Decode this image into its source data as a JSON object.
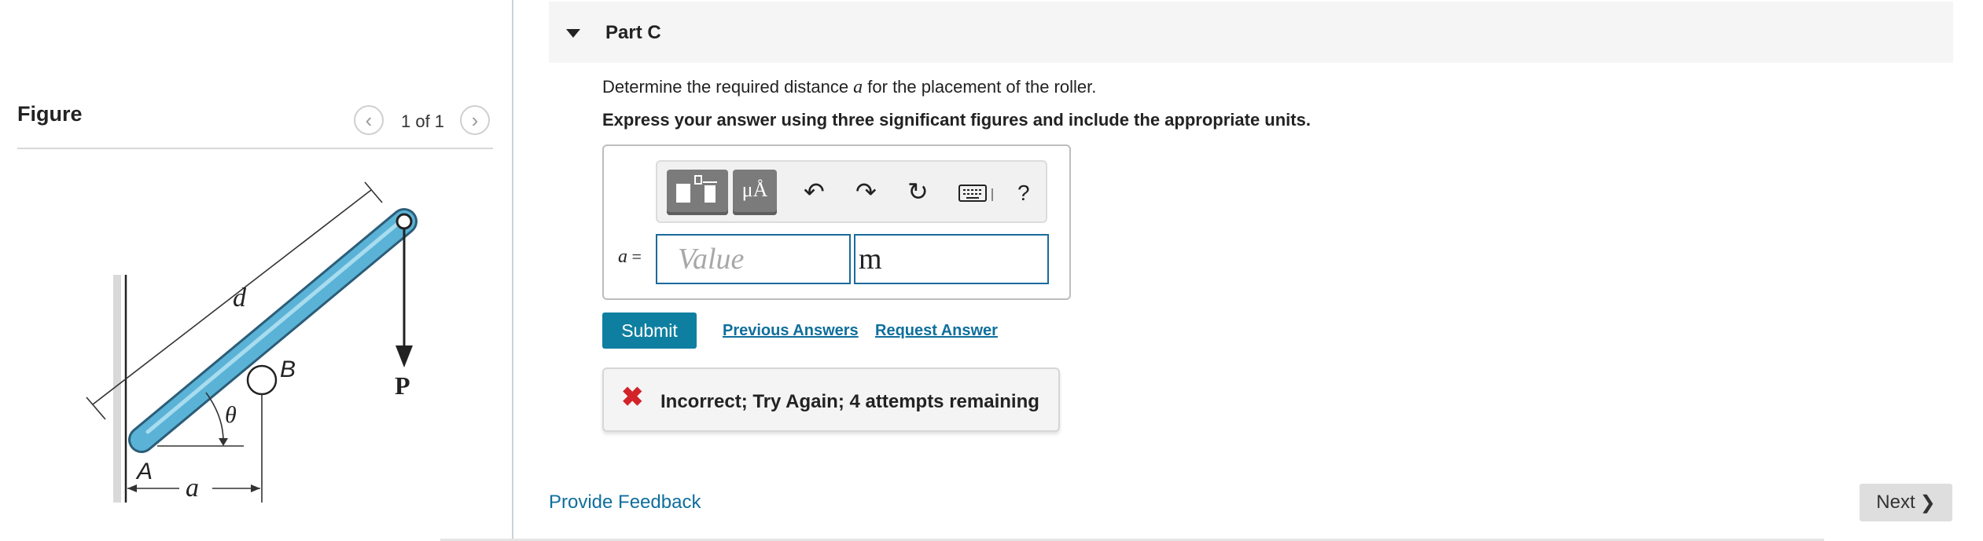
{
  "figure_panel": {
    "title": "Figure",
    "pager": "1 of 1",
    "prev_icon": "chevron-left-icon",
    "next_icon": "chevron-right-icon",
    "diagram_labels": {
      "d": "d",
      "B": "B",
      "P": "P",
      "theta": "θ",
      "A": "A",
      "a": "a"
    }
  },
  "part": {
    "title": "Part C",
    "question_prefix": "Determine the required distance ",
    "question_var": "a",
    "question_suffix": " for the placement of the roller.",
    "instruction": "Express your answer using three significant figures and include the appropriate units."
  },
  "answer": {
    "toolbar": {
      "units_label": "μÅ",
      "help_label": "?",
      "icons": [
        "templates-icon",
        "units-icon",
        "undo-icon",
        "redo-icon",
        "reset-icon",
        "keyboard-icon",
        "help-icon"
      ]
    },
    "var_name": "a",
    "var_equals": " =",
    "value_placeholder": "Value",
    "unit_value": "m"
  },
  "actions": {
    "submit": "Submit",
    "previous_answers": "Previous Answers",
    "request_answer": "Request Answer"
  },
  "feedback": {
    "icon": "x-icon",
    "message": "Incorrect; Try Again; 4 attempts remaining"
  },
  "footer": {
    "provide_feedback": "Provide Feedback",
    "next": "Next"
  },
  "colors": {
    "accent": "#0f7fa1",
    "link": "#0f6f9c",
    "error": "#d2232a",
    "bar_fill": "#5ab3d6"
  }
}
